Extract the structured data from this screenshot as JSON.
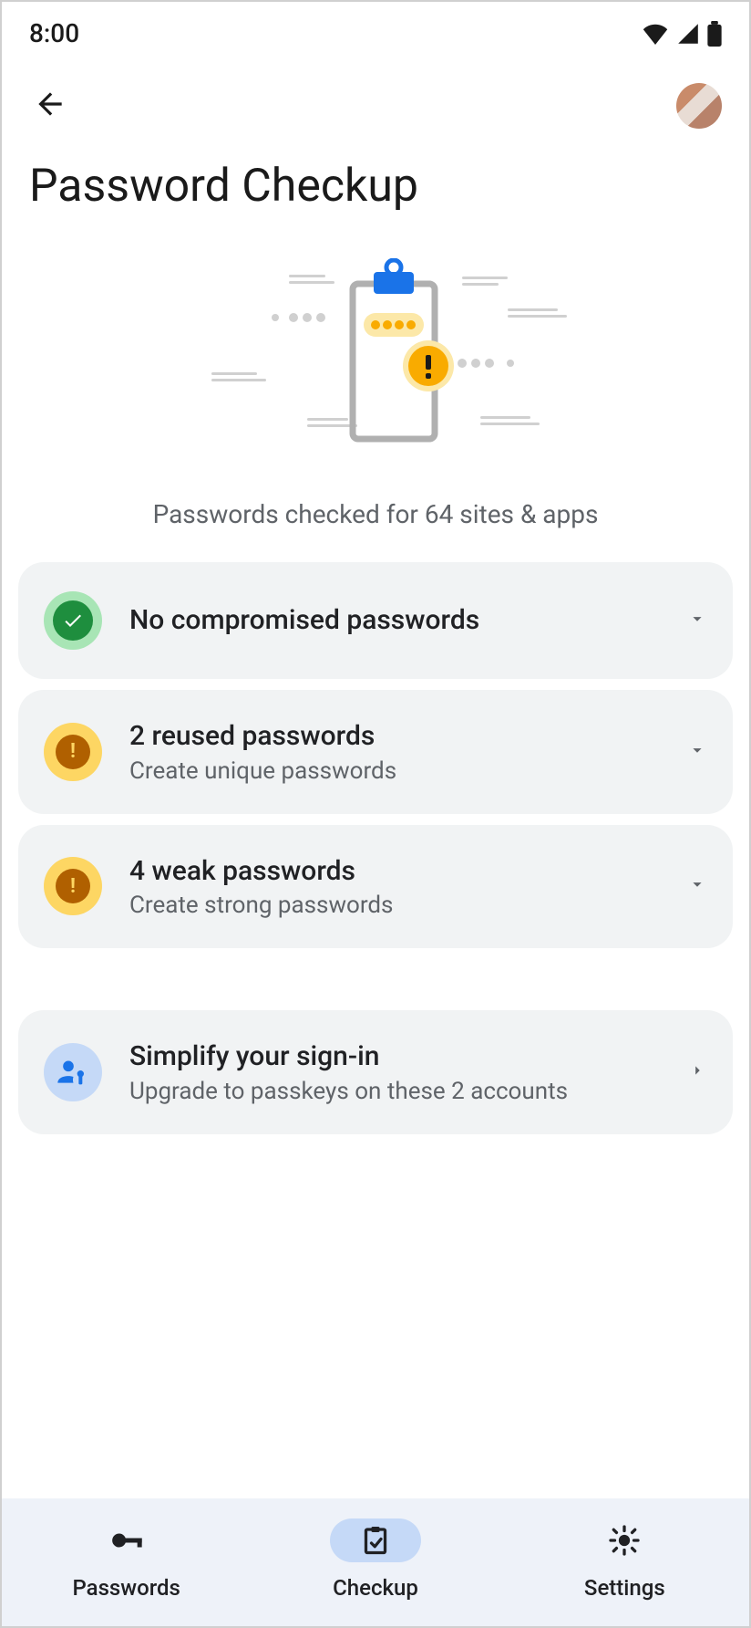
{
  "status": {
    "time": "8:00"
  },
  "header": {
    "title": "Password Checkup"
  },
  "subtitle": "Passwords checked for 64 sites & apps",
  "cards": {
    "compromised": {
      "title": "No compromised passwords"
    },
    "reused": {
      "title": "2 reused passwords",
      "sub": "Create unique passwords"
    },
    "weak": {
      "title": "4 weak passwords",
      "sub": "Create strong passwords"
    },
    "passkeys": {
      "title": "Simplify your sign-in",
      "sub": "Upgrade to passkeys on these 2 accounts"
    }
  },
  "nav": {
    "passwords": "Passwords",
    "checkup": "Checkup",
    "settings": "Settings"
  }
}
